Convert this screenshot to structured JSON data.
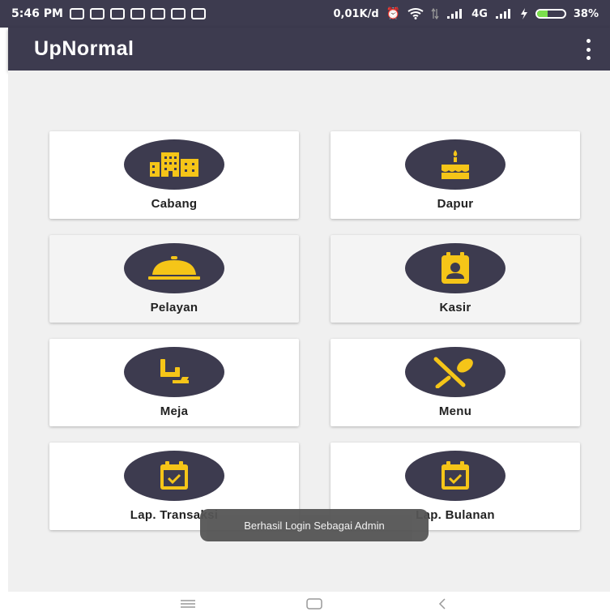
{
  "status_bar": {
    "time": "5:46 PM",
    "network_speed": "0,01K/d",
    "network_type": "4G",
    "battery": "38%",
    "battery_level": 0.38,
    "battery_color": "#7be04c",
    "notification_icons": [
      "whatsapp-icon",
      "download-icon",
      "instagram-icon",
      "app-icon",
      "google-icon",
      "message-icon",
      "telegram-icon"
    ],
    "status_icons": [
      "alarm-icon",
      "wifi-icon",
      "data-icon",
      "signal-icon",
      "signal-icon",
      "charging-icon"
    ]
  },
  "app_bar": {
    "title": "UpNormal",
    "menu_icon": "overflow-menu-icon",
    "background": "#3d3b4f"
  },
  "menu": {
    "accent_color": "#f5c518",
    "items": [
      {
        "label": "Cabang",
        "icon": "building-icon"
      },
      {
        "label": "Dapur",
        "icon": "cake-icon"
      },
      {
        "label": "Pelayan",
        "icon": "cloche-icon"
      },
      {
        "label": "Kasir",
        "icon": "badge-icon"
      },
      {
        "label": "Meja",
        "icon": "chair-icon"
      },
      {
        "label": "Menu",
        "icon": "fork-spoon-icon"
      },
      {
        "label": "Lap. Transaksi",
        "icon": "calendar-check-icon"
      },
      {
        "label": "Lap. Bulanan",
        "icon": "calendar-check-icon"
      }
    ]
  },
  "toast": {
    "text": "Berhasil Login Sebagai Admin"
  },
  "nav_bar": {
    "icons": [
      "menu-nav-icon",
      "home-nav-icon",
      "back-nav-icon"
    ]
  }
}
